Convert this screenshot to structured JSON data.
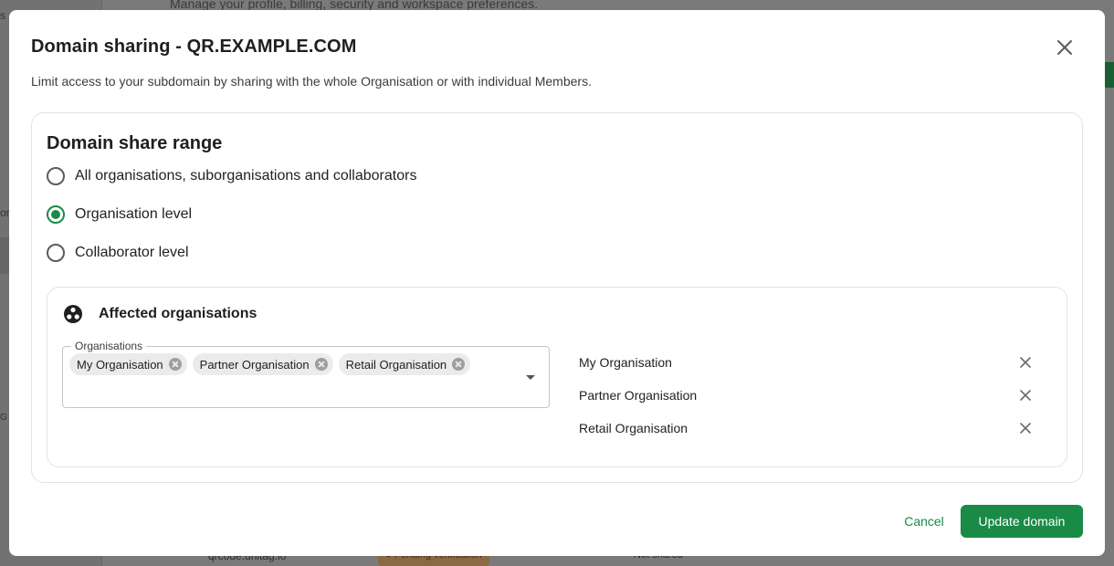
{
  "background": {
    "header_text": "Manage your profile, billing, security and workspace preferences.",
    "row_domain": "qrcode.unitag.io",
    "row_status": "● Pending verification",
    "row_shared": "Not shared",
    "left_frag_1": "on",
    "left_frag_2": "s",
    "left_frag_3": "G"
  },
  "modal": {
    "title": "Domain sharing - QR.EXAMPLE.COM",
    "subtitle": "Limit access to your subdomain by sharing with the whole Organisation or with individual Members.",
    "close_icon": "close-icon"
  },
  "share_range": {
    "title": "Domain share range",
    "options": [
      {
        "label": "All organisations, suborganisations and collaborators",
        "checked": false
      },
      {
        "label": "Organisation level",
        "checked": true
      },
      {
        "label": "Collaborator level",
        "checked": false
      }
    ]
  },
  "affected": {
    "title": "Affected organisations",
    "icon": "organisations-icon",
    "select_label": "Organisations",
    "chips": [
      "My Organisation",
      "Partner Organisation",
      "Retail Organisation"
    ],
    "list": [
      "My Organisation",
      "Partner Organisation",
      "Retail Organisation"
    ]
  },
  "footer": {
    "cancel_label": "Cancel",
    "update_label": "Update domain"
  },
  "colors": {
    "accent": "#1a8a47",
    "overlay": "#7a7a7a"
  }
}
